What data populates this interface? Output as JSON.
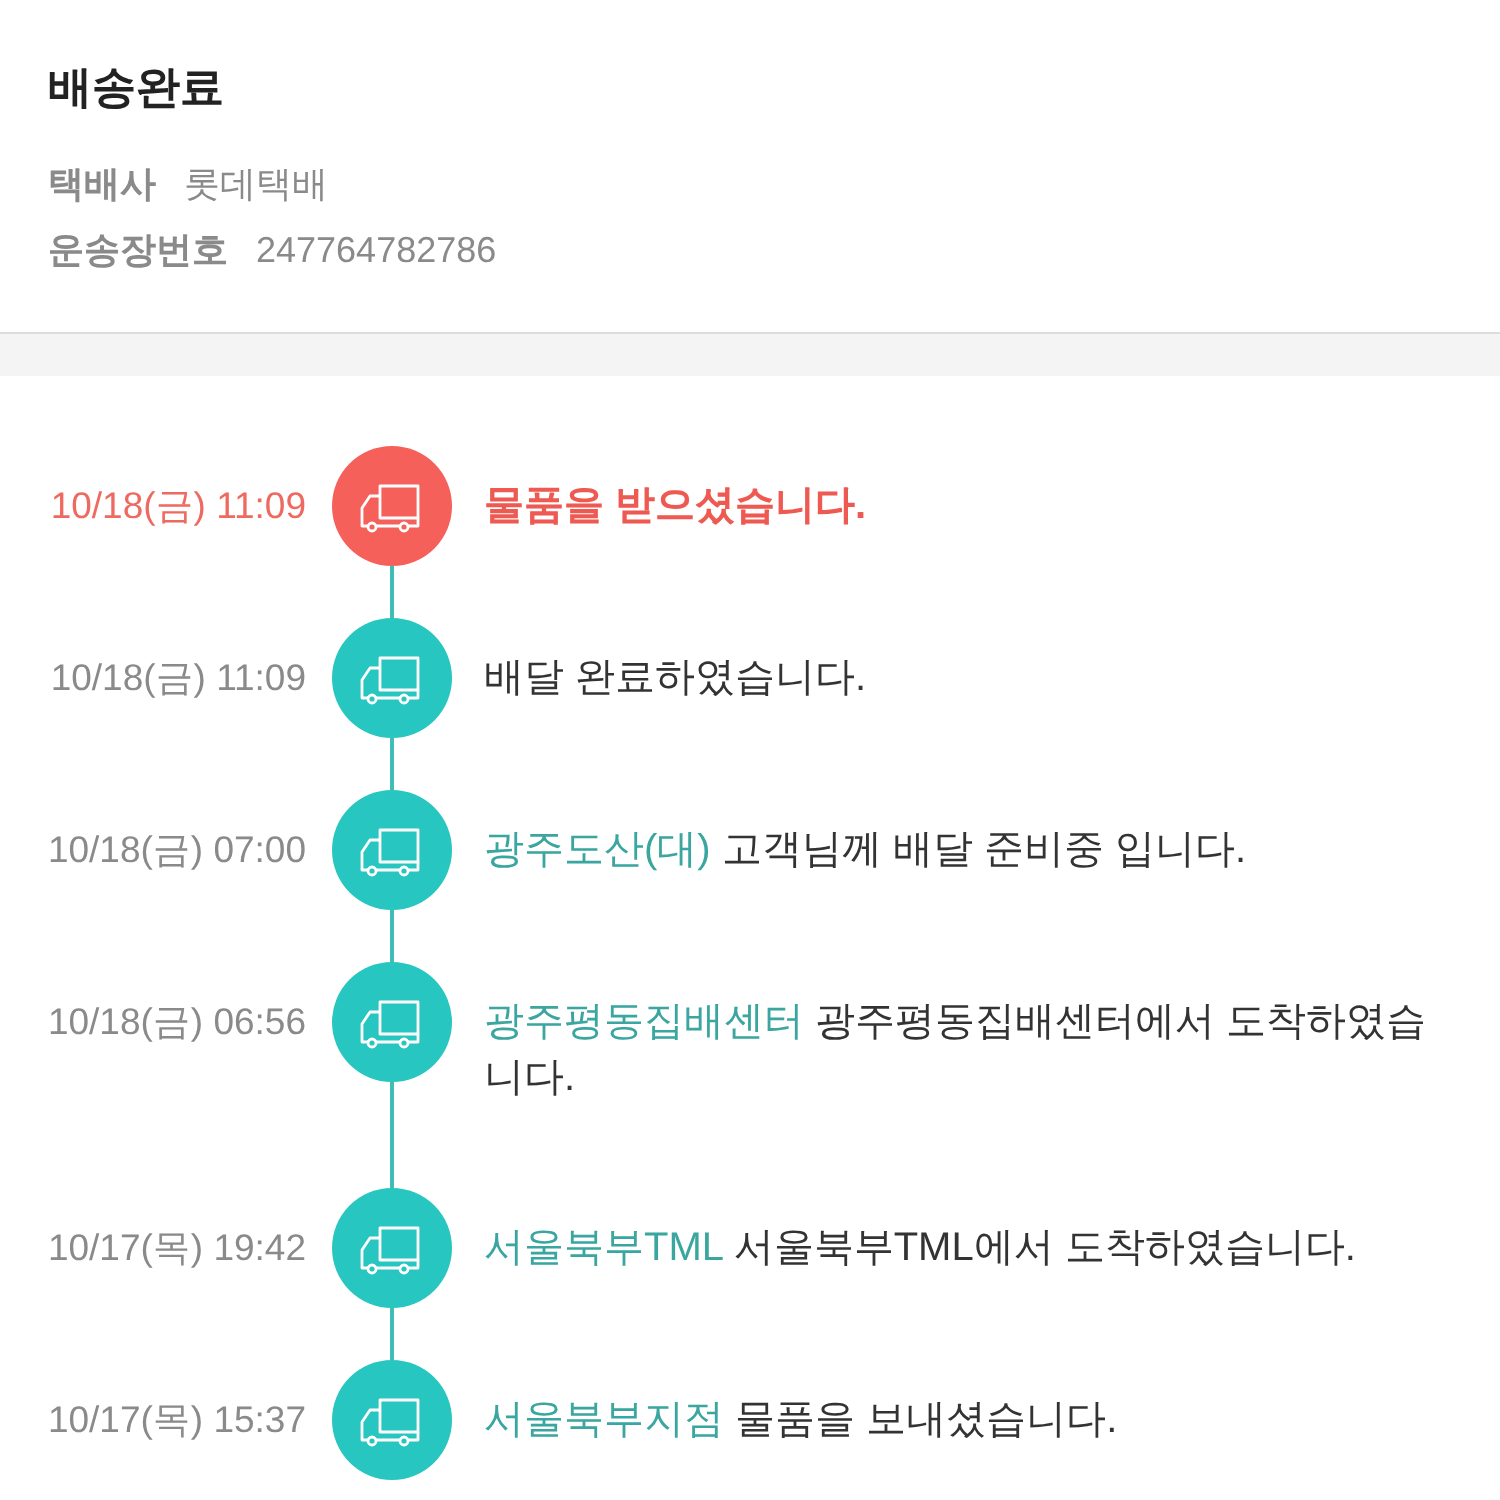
{
  "header": {
    "status": "배송완료",
    "details": [
      {
        "label": "택배사",
        "value": "롯데택배"
      },
      {
        "label": "운송장번호",
        "value": "247764782786"
      }
    ]
  },
  "events": [
    {
      "time": "10/18(금) 11:09",
      "message": "물품을 받으셨습니다.",
      "current": true
    },
    {
      "time": "10/18(금) 11:09",
      "message": "배달 완료하였습니다.",
      "current": false
    },
    {
      "time": "10/18(금) 07:00",
      "location": "광주도산(대)",
      "message": "고객님께 배달 준비중 입니다.",
      "current": false
    },
    {
      "time": "10/18(금) 06:56",
      "location": "광주평동집배센터",
      "message": "광주평동집배센터에서 도착하였습니다.",
      "current": false
    },
    {
      "time": "10/17(목) 19:42",
      "location": "서울북부TML",
      "message": "서울북부TML에서 도착하였습니다.",
      "current": false
    },
    {
      "time": "10/17(목) 15:37",
      "location": "서울북부지점",
      "message": "물품을 보내셨습니다.",
      "current": false
    }
  ]
}
